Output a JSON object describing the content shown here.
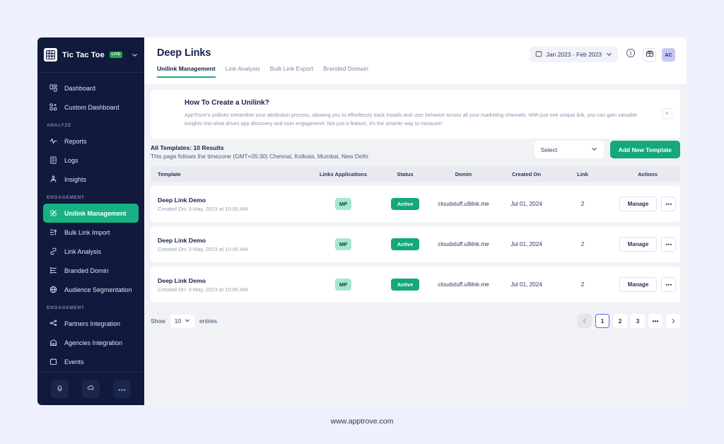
{
  "sidebar": {
    "brand": {
      "name": "Tic Tac Toe",
      "badge": "LIVE",
      "logo_icon": "tic-tac-toe-icon",
      "caret_icon": "chevron-down-icon"
    },
    "groups": [
      {
        "label": "",
        "items": [
          {
            "label": "Dashboard",
            "icon": "dashboard-icon",
            "active": false
          },
          {
            "label": "Custom Dashboard",
            "icon": "custom-dashboard-icon",
            "active": false
          }
        ]
      },
      {
        "label": "ANALYZE",
        "items": [
          {
            "label": "Reports",
            "icon": "pulse-icon",
            "active": false
          },
          {
            "label": "Logs",
            "icon": "logs-icon",
            "active": false
          },
          {
            "label": "Insights",
            "icon": "insights-icon",
            "active": false
          }
        ]
      },
      {
        "label": "ENGAGEMENT",
        "items": [
          {
            "label": "Unilink Management",
            "icon": "unilink-icon",
            "active": true
          },
          {
            "label": "Bulk Link Import",
            "icon": "bulk-import-icon",
            "active": false
          },
          {
            "label": "Link Analysis",
            "icon": "link-icon",
            "active": false
          },
          {
            "label": "Branded Domin",
            "icon": "list-icon",
            "active": false
          },
          {
            "label": "Audience Segmentation",
            "icon": "globe-icon",
            "active": false
          }
        ]
      },
      {
        "label": "ENGAGEMENT",
        "items": [
          {
            "label": "Partners Integration",
            "icon": "share-nodes-icon",
            "active": false
          },
          {
            "label": "Agencies Integration",
            "icon": "agency-icon",
            "active": false
          },
          {
            "label": "Events",
            "icon": "calendar-icon",
            "active": false
          }
        ]
      }
    ],
    "footer_buttons": [
      {
        "icon": "bell-icon",
        "name": "notifications-button"
      },
      {
        "icon": "cloud-icon",
        "name": "cloud-button"
      },
      {
        "icon": "more-icon",
        "name": "more-button"
      }
    ]
  },
  "header": {
    "title": "Deep Links",
    "tabs": [
      {
        "label": "Unilink Management",
        "active": true
      },
      {
        "label": "Link Analysis",
        "active": false
      },
      {
        "label": "Bulk Link Export",
        "active": false
      },
      {
        "label": "Branded Domain",
        "active": false
      }
    ],
    "date_range": "Jan 2023 - Feb 2023",
    "calendar_icon": "calendar-icon",
    "caret_icon": "chevron-down-icon",
    "info_icon": "info-icon",
    "gift_icon": "gift-icon",
    "avatar_initials": "AC"
  },
  "banner": {
    "title": "How To Create a Unilink?",
    "body": "AppTrove's unilinks streamline your attribution process, allowing you to effortlessly track installs and user behavior across all your marketing channels. With just one unique link, you can gain valuable insights into what drives app discovery and user engagement. Not just a feature, it's the smarter way to measure!",
    "close_label": "×"
  },
  "table_toolbar": {
    "results_title": "All Templates: 10 Results",
    "timezone_note": "This page follows the timezone (GMT+05:30) Chennai, Kolkata, Mumbai, New Delhi",
    "select_placeholder": "Select",
    "add_button": "Add New Template"
  },
  "table": {
    "columns": [
      "Template",
      "Links Applications",
      "Status",
      "Domin",
      "Created On",
      "Link",
      "Actions"
    ],
    "rows": [
      {
        "template": "Deep Link Demo",
        "created_meta": "Created On: 3 May, 2023 at 10:00 AM",
        "app": "MP",
        "status": "Active",
        "domain": "cloudstuff.u9ilnk.me",
        "created_on": "Jul 01, 2024",
        "link": "2",
        "manage_label": "Manage",
        "more_label": "•••"
      },
      {
        "template": "Deep Link Demo",
        "created_meta": "Created On: 3 May, 2023 at 10:00 AM",
        "app": "MP",
        "status": "Active",
        "domain": "cloudstuff.u9ilnk.me",
        "created_on": "Jul 01, 2024",
        "link": "2",
        "manage_label": "Manage",
        "more_label": "•••"
      },
      {
        "template": "Deep Link Demo",
        "created_meta": "Created On: 3 May, 2023 at 10:00 AM",
        "app": "MP",
        "status": "Active",
        "domain": "cloudstuff.u9ilnk.me",
        "created_on": "Jul 01, 2024",
        "link": "2",
        "manage_label": "Manage",
        "more_label": "•••"
      }
    ]
  },
  "pagination": {
    "show_label": "Show",
    "page_size": "10",
    "entries_label": "entries",
    "prev_icon": "chevron-left-icon",
    "next_icon": "chevron-right-icon",
    "pages": [
      "1",
      "2",
      "3"
    ],
    "ellipsis": "•••",
    "current_page": "1"
  },
  "footer": {
    "site_url": "www.apptrove.com"
  },
  "colors": {
    "page_bg": "#eef1fb",
    "sidebar_bg": "#111a3d",
    "accent_green": "#14a87c",
    "active_nav": "#17b184",
    "content_bg": "#f1f2f5",
    "pager_active_border": "#6366e8",
    "live_badge": "#23a24d"
  }
}
